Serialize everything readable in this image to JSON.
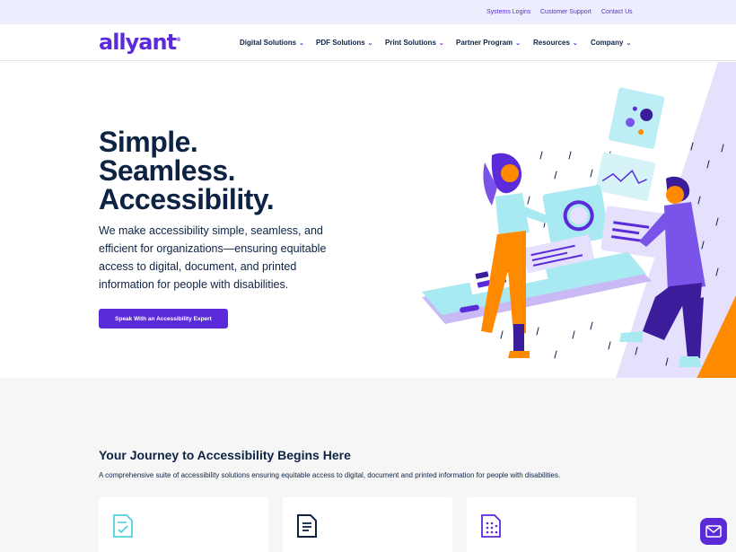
{
  "utility_links": [
    "Systems Logins",
    "Customer Support",
    "Contact Us"
  ],
  "logo": {
    "text": "allyant",
    "mark": "®"
  },
  "nav": {
    "items": [
      {
        "label": "Digital Solutions"
      },
      {
        "label": "PDF Solutions"
      },
      {
        "label": "Print Solutions"
      },
      {
        "label": "Partner Program"
      },
      {
        "label": "Resources"
      },
      {
        "label": "Company"
      }
    ]
  },
  "hero": {
    "title_lines": [
      "Simple.",
      "Seamless.",
      "Accessibility."
    ],
    "description": "We make accessibility simple, seamless, and efficient for organizations—ensuring equitable access to digital, document, and printed information for people with disabilities.",
    "cta_label": "Speak With an Accessibility Expert",
    "illustration": "people-interacting-with-accessible-screens-illustration"
  },
  "section": {
    "title": "Your Journey to Accessibility Begins Here",
    "subtitle": "A comprehensive suite of accessibility solutions ensuring equitable access to digital, document and printed information for people with disabilities."
  },
  "cards": [
    {
      "icon": "document-check-icon",
      "color": "#4fd3de"
    },
    {
      "icon": "document-lines-icon",
      "color": "#0d2344"
    },
    {
      "icon": "braille-document-icon",
      "color": "#5b2bd9"
    }
  ],
  "chat": {
    "icon": "envelope-icon"
  },
  "colors": {
    "brand": "#5b2bd9",
    "navy": "#0d2344",
    "orange": "#ff8a00",
    "lavender": "#e5e0fb",
    "utility_bg": "#eceefe"
  }
}
